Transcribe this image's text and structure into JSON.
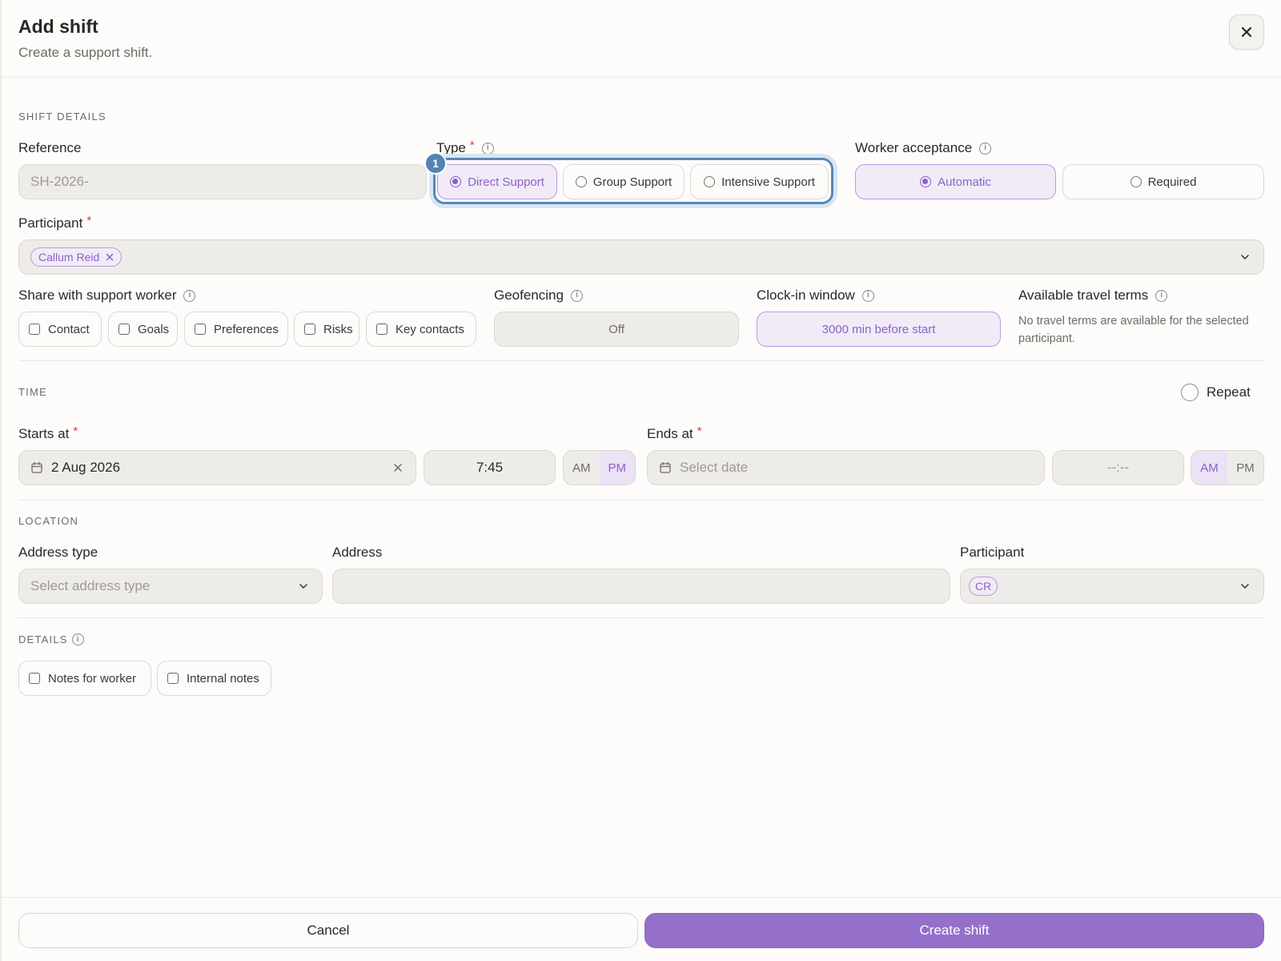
{
  "header": {
    "title": "Add shift",
    "subtitle": "Create a support shift."
  },
  "shift_details": {
    "section_label": "SHIFT DETAILS",
    "reference": {
      "label": "Reference",
      "value": "SH-2026-"
    },
    "type": {
      "label": "Type",
      "options": [
        "Direct Support",
        "Group Support",
        "Intensive Support"
      ],
      "selected": "Direct Support",
      "step_badge": "1"
    },
    "worker_acceptance": {
      "label": "Worker acceptance",
      "options": [
        "Automatic",
        "Required"
      ],
      "selected": "Automatic"
    },
    "participant": {
      "label": "Participant",
      "selected_token": "Callum Reid"
    },
    "share_with_support_worker": {
      "label": "Share with support worker",
      "options": [
        "Contact",
        "Goals",
        "Preferences",
        "Risks",
        "Key contacts"
      ]
    },
    "geofencing": {
      "label": "Geofencing",
      "value": "Off"
    },
    "clock_in_window": {
      "label": "Clock-in window",
      "value": "3000 min before start"
    },
    "available_travel_terms": {
      "label": "Available travel terms",
      "message": "No travel terms are available for the selected participant."
    }
  },
  "time": {
    "section_label": "TIME",
    "repeat_label": "Repeat",
    "starts_at": {
      "label": "Starts at",
      "date": "2 Aug 2026",
      "time": "7:45",
      "am": "AM",
      "pm": "PM",
      "selected_period": "PM"
    },
    "ends_at": {
      "label": "Ends at",
      "date_placeholder": "Select date",
      "time_placeholder": "--:--",
      "am": "AM",
      "pm": "PM",
      "selected_period": "AM"
    }
  },
  "location": {
    "section_label": "LOCATION",
    "address_type": {
      "label": "Address type",
      "placeholder": "Select address type"
    },
    "address": {
      "label": "Address",
      "value": ""
    },
    "participant": {
      "label": "Participant",
      "token": "CR"
    }
  },
  "details": {
    "section_label": "DETAILS",
    "options": [
      "Notes for worker",
      "Internal notes"
    ]
  },
  "footer": {
    "cancel_label": "Cancel",
    "create_label": "Create shift"
  },
  "colors": {
    "accent": "#9570ca",
    "highlight_ring": "#5a88b8",
    "required_star": "#d8403a"
  }
}
